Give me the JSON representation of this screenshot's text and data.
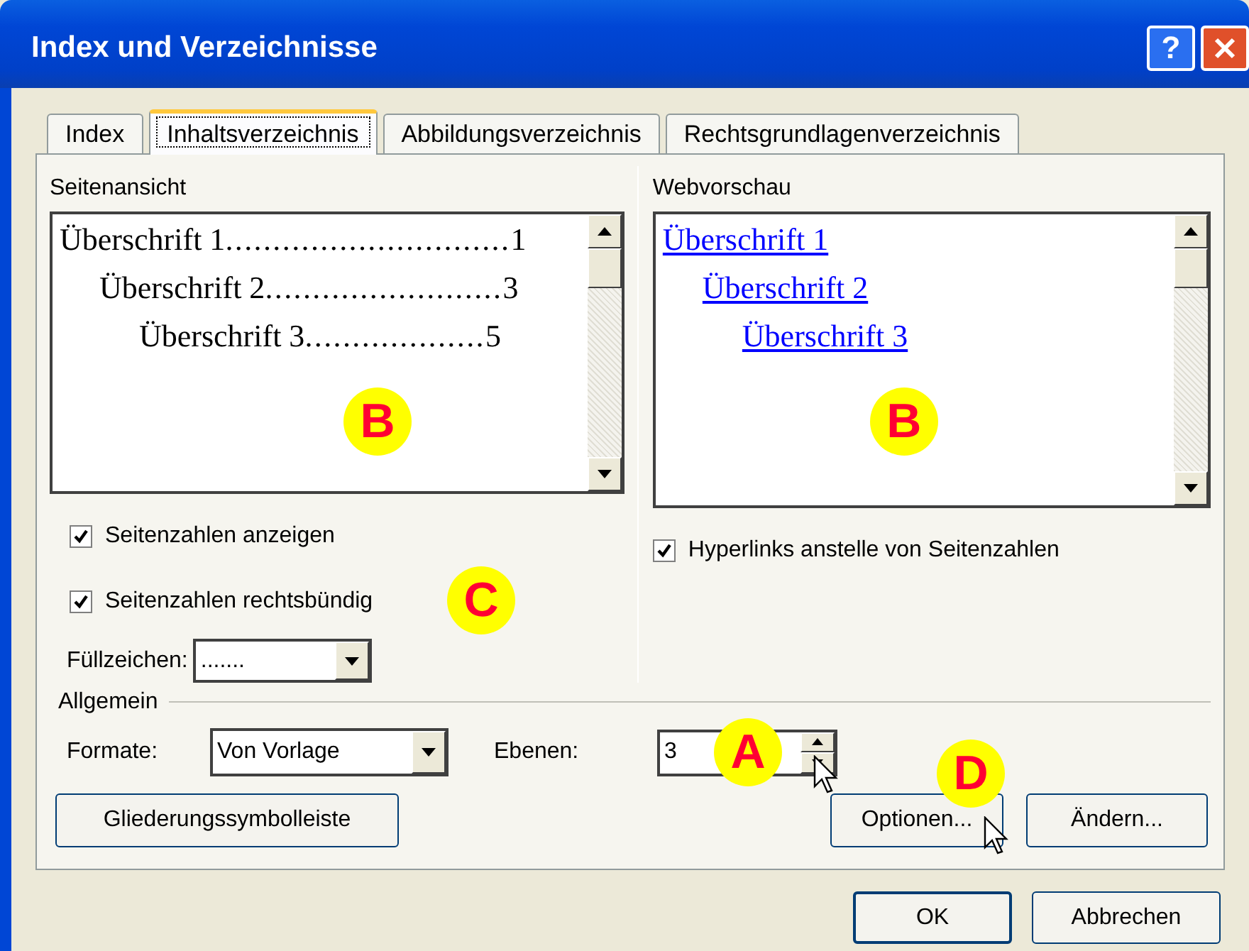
{
  "window": {
    "title": "Index und Verzeichnisse",
    "help": "?"
  },
  "tabs": [
    {
      "label": "Index",
      "selected": false
    },
    {
      "label": "Inhaltsverzeichnis",
      "selected": true
    },
    {
      "label": "Abbildungsverzeichnis",
      "selected": false
    },
    {
      "label": "Rechtsgrundlagenverzeichnis",
      "selected": false
    }
  ],
  "page_view": {
    "label": "Seitenansicht",
    "marker": "B",
    "entries": [
      {
        "text": "Überschrift 1",
        "leader": "..............................",
        "page": "1",
        "children": [
          {
            "text": "Überschrift 2",
            "leader": ".........................",
            "page": "3",
            "children": [
              {
                "text": "Überschrift 3",
                "leader": "...................",
                "page": "5"
              }
            ]
          }
        ]
      }
    ]
  },
  "web_preview": {
    "label": "Webvorschau",
    "marker": "B",
    "entries": [
      {
        "text": "Überschrift 1",
        "children": [
          {
            "text": "Überschrift 2",
            "children": [
              {
                "text": "Überschrift 3"
              }
            ]
          }
        ]
      }
    ]
  },
  "options": {
    "marker": "C",
    "items": [
      {
        "label": "Seitenzahlen anzeigen",
        "checked": true
      },
      {
        "label": "Seitenzahlen rechtsbündig",
        "checked": true
      }
    ]
  },
  "fill_char": {
    "label": "Füllzeichen:",
    "value": "......."
  },
  "web_options": [
    {
      "label": "Hyperlinks anstelle von Seitenzahlen",
      "checked": true
    }
  ],
  "general": {
    "label": "Allgemein",
    "formats": {
      "label": "Formate:",
      "value": "Von Vorlage"
    },
    "levels": {
      "label": "Ebenen:",
      "value": "3",
      "marker": "A"
    }
  },
  "outline_button": "Gliederungssymbolleiste",
  "options_button": {
    "label": "Optionen...",
    "marker": "D"
  },
  "modify_button": "Ändern...",
  "dialog_buttons": [
    {
      "label": "OK",
      "default": true
    },
    {
      "label": "Abbrechen",
      "default": false
    }
  ]
}
